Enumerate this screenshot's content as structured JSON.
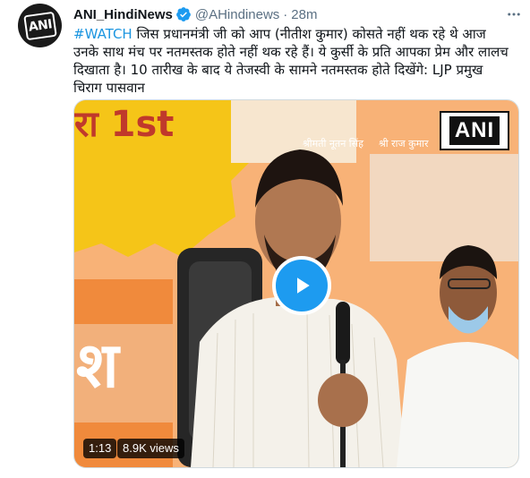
{
  "tweet": {
    "display_name": "ANI_HindiNews",
    "handle": "@AHindinews",
    "separator": "·",
    "time": "28m",
    "avatar_text": "ANI",
    "hashtag": "#WATCH",
    "body": " जिस प्रधानमंत्री जी को आप (नीतीश कुमार) कोसते नहीं थक रहे थे आज उनके साथ मंच पर नतमस्तक होते नहीं थक रहे हैं। ये कुर्सी के प्रति आपका प्रेम और लालच दिखाता है। 10 तारीख के बाद ये तेजस्वी के सामने नतमस्तक होते दिखेंगे: LJP प्रमुख चिराग पासवान"
  },
  "video": {
    "duration": "1:13",
    "views": "8.9K views",
    "watermark": "ANI",
    "banner_text": "रा 1st",
    "banner_text_2": "श",
    "caption_left": "श्रीमती नूतन सिंह",
    "caption_right": "श्री राज कुमार"
  },
  "icons": {
    "verified": "verified-badge-icon",
    "more": "more-options-icon",
    "play": "play-icon"
  },
  "colors": {
    "link": "#1b95e0",
    "accent": "#1d9bf0",
    "secondary_text": "#5b7083",
    "banner_orange": "#f47b20",
    "banner_yellow": "#f5c518"
  }
}
